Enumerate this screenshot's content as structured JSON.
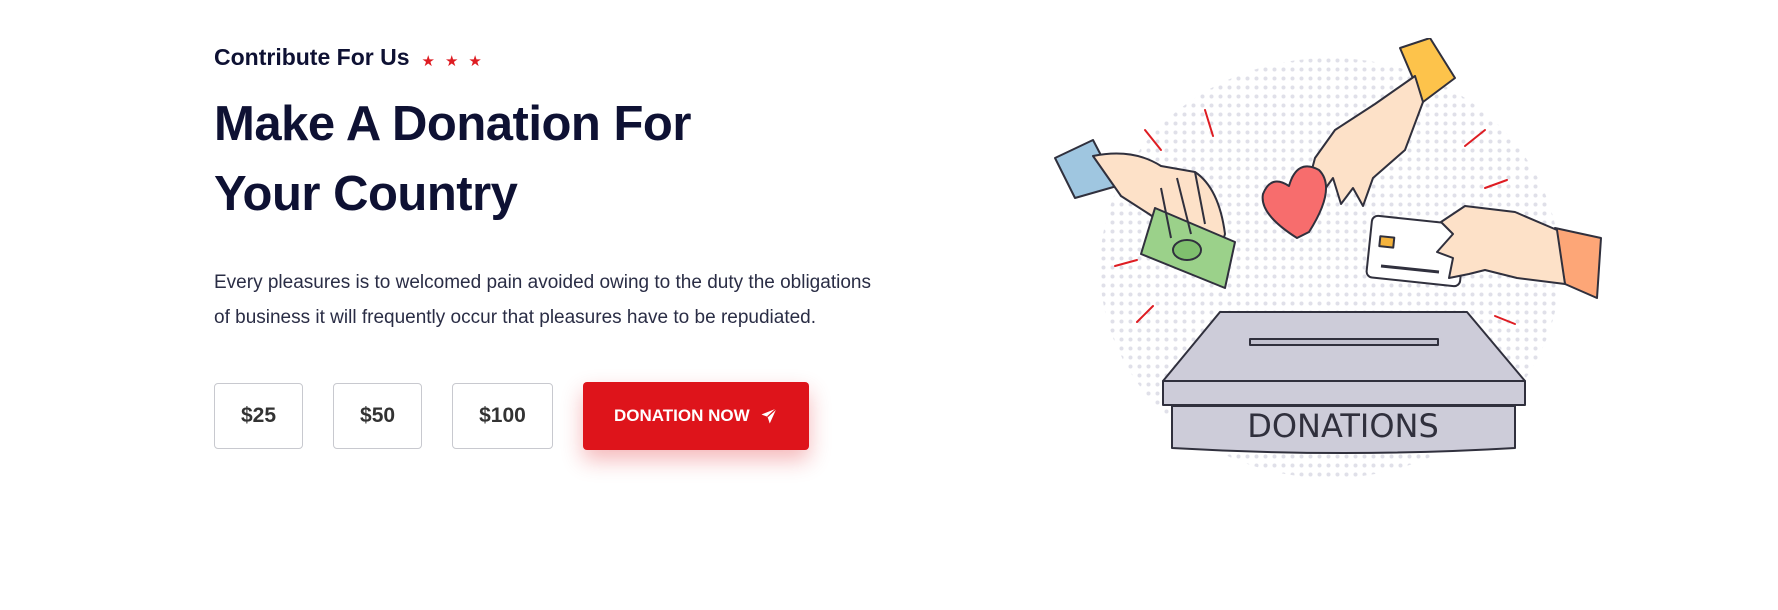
{
  "section": {
    "eyebrow": "Contribute For Us",
    "stars": [
      "★",
      "★",
      "★"
    ],
    "title_lines": [
      "Make A Donation For",
      "Your Country"
    ],
    "description_lines": [
      "Every pleasures is to welcomed pain avoided owing to the duty the obligations",
      "of business it will frequently occur that pleasures have to be repudiated."
    ]
  },
  "amounts": [
    "$25",
    "$50",
    "$100"
  ],
  "cta": {
    "label": "DONATION NOW",
    "icon": "paper-plane-icon"
  },
  "illustration": {
    "box_label": "DONATIONS"
  },
  "colors": {
    "accent": "#de141b",
    "heading": "#0e1133",
    "body": "#2a2d45"
  }
}
